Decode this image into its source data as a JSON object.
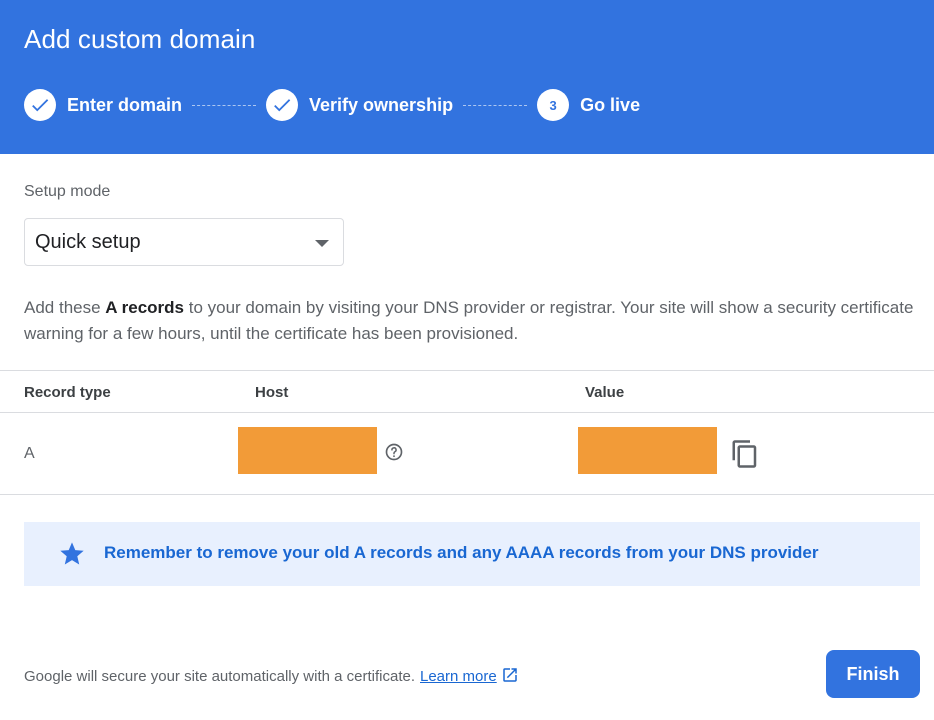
{
  "header": {
    "title": "Add custom domain",
    "steps": [
      {
        "label": "Enter domain",
        "status": "done"
      },
      {
        "label": "Verify ownership",
        "status": "done"
      },
      {
        "label": "Go live",
        "status": "current",
        "number": "3"
      }
    ]
  },
  "setup": {
    "label": "Setup mode",
    "selected": "Quick setup"
  },
  "description": {
    "before": "Add these ",
    "bold": "A records",
    "after": " to your domain by visiting your DNS provider or registrar. Your site will show a security certificate warning for a few hours, until the certificate has been provisioned."
  },
  "table": {
    "headers": {
      "type": "Record type",
      "host": "Host",
      "value": "Value"
    },
    "rows": [
      {
        "type": "A",
        "host_redacted": true,
        "value_redacted": true
      }
    ]
  },
  "banner": {
    "text": "Remember to remove your old A records and any AAAA records from your DNS provider",
    "icon": "star-icon"
  },
  "footer": {
    "text": "Google will secure your site automatically with a certificate.",
    "link": "Learn more"
  },
  "actions": {
    "finish_label": "Finish"
  },
  "colors": {
    "primary": "#3273df",
    "redaction": "#f29b38",
    "banner_bg": "#e8f0fe",
    "link": "#1967d2"
  }
}
